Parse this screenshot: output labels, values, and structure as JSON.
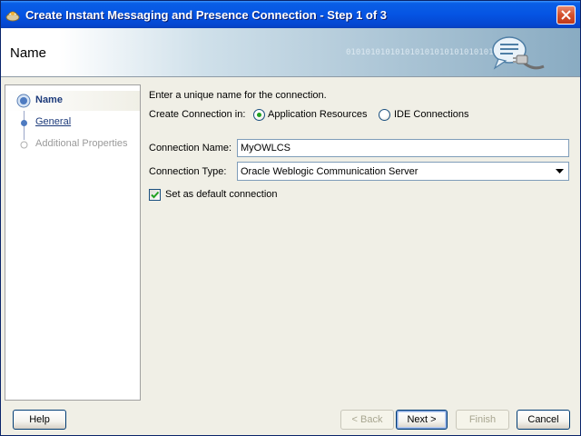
{
  "window": {
    "title": "Create Instant Messaging and Presence Connection - Step 1 of 3"
  },
  "header": {
    "title": "Name",
    "binary_decor": "01010101010101010101010101010101"
  },
  "steps": [
    {
      "label": "Name",
      "state": "active"
    },
    {
      "label": "General",
      "state": "link"
    },
    {
      "label": "Additional Properties",
      "state": "disabled"
    }
  ],
  "form": {
    "instruction": "Enter a unique name for the connection.",
    "create_in_label": "Create Connection in:",
    "radio_app_resources": "Application Resources",
    "radio_ide_connections": "IDE Connections",
    "selected_radio": "Application Resources",
    "connection_name_label": "Connection Name:",
    "connection_name_value": "MyOWLCS",
    "connection_type_label": "Connection Type:",
    "connection_type_value": "Oracle Weblogic Communication Server",
    "default_checkbox_label": "Set as default connection",
    "default_checked": true
  },
  "buttons": {
    "help": "Help",
    "back": "< Back",
    "next": "Next >",
    "finish": "Finish",
    "cancel": "Cancel"
  },
  "colors": {
    "titlebar": "#0554e3",
    "link": "#1c3a7a",
    "panel": "#f0efe6"
  }
}
